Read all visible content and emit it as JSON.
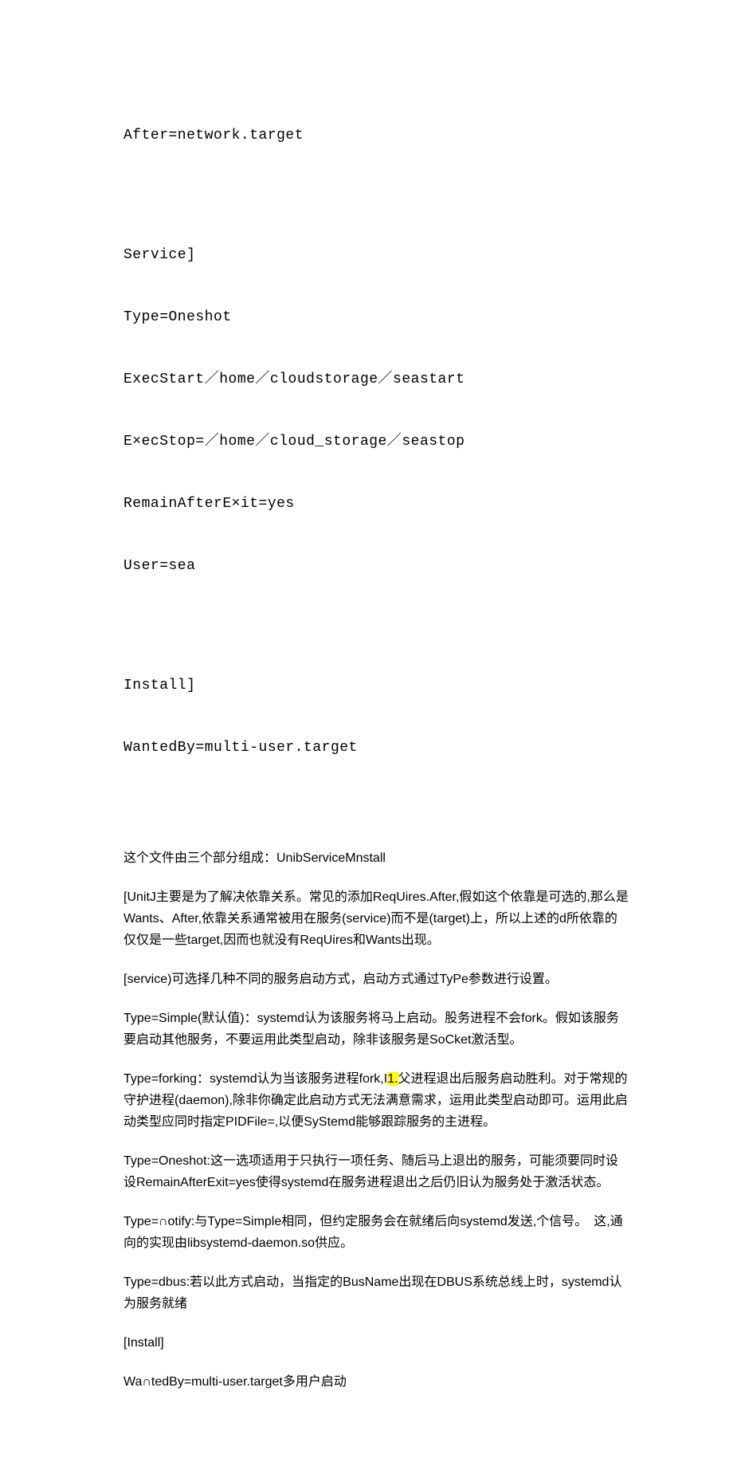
{
  "code": {
    "l1": "After=network.target",
    "l2": "Service]",
    "l3": "Type=Oneshot",
    "l4": "ExecStart／home／cloudstorage／seastart",
    "l5": "E×ecStop=／home／cloud_storage／seastop",
    "l6": "RemainAfterE×it=yes",
    "l7": "User=sea",
    "l8": "Install]",
    "l9": "WantedBy=multi-user.target"
  },
  "p1": "这个文件由三个部分组成：UnibServiceMnstall",
  "p2": "[UnitJ主要是为了解决依靠关系。常见的添加ReqUires.After,假如这个依靠是可选的,那么是Wants、After,依靠关系通常被用在服务(service)而不是(target)上，所以上述的d所依靠的仅仅是一些target,因而也就没有ReqUires和Wants出现。",
  "p3": "[service)可选择几种不同的服务启动方式，启动方式通过TyPe参数进行设置。",
  "p4": "Type=Simple(默认值)：systemd认为该服务将马上启动。股务进程不会fork。假如该服务要启动其他服务，不要运用此类型启动，除非该服务是SoCket激活型。",
  "p5a": "Type=forking：systemd认为当该服务进程fork,I",
  "p5hl": "1.",
  "p5b": "父进程退出后服务启动胜利。对于常规的守护进程(daemon),除非你确定此启动方式无法满意需求，运用此类型启动即可。运用此启动类型应同时指定PIDFile=,以便SyStemd能够跟踪服务的主进程。",
  "p6": "Type=Oneshot:这一选项适用于只执行一项任务、随后马上退出的服务，可能须要同时设设RemainAfterExit=yes使得systemd在服务进程退出之后仍旧认为服务处于激活状态。",
  "p7": "Type=∩otify:与Type=Simple相同，但约定服务会在就绪后向systemd发送,个信号。　这,通向的实现由libsystemd-daemon.so供应。",
  "p8": "Type=dbus:若以此方式启动，当指定的BusName出现在DBUS系统总线上时，systemd认为服务就绪",
  "p9": "[Install]",
  "p10": "Wa∩tedBy=multi-user.target多用户启动"
}
